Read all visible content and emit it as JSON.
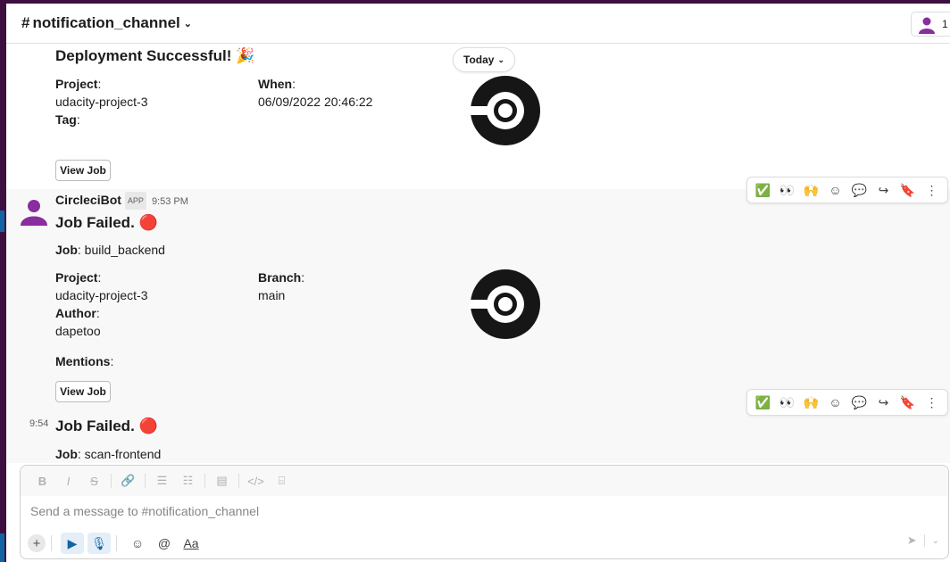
{
  "header": {
    "hash": "#",
    "channel": "notification_channel",
    "member_count": "1"
  },
  "today_label": "Today",
  "msg1": {
    "title": "Deployment Successful! 🎉",
    "project_label": "Project",
    "project_value": "udacity-project-3",
    "when_label": "When",
    "when_value": "06/09/2022 20:46:22",
    "tag_label": "Tag",
    "button": "View Job"
  },
  "msg2": {
    "sender": "CircleciBot",
    "badge": "APP",
    "time": "9:53 PM",
    "title": "Job Failed. 🔴",
    "job_label": "Job",
    "job_value": "build_backend",
    "project_label": "Project",
    "project_value": "udacity-project-3",
    "branch_label": "Branch",
    "branch_value": "main",
    "author_label": "Author",
    "author_value": "dapetoo",
    "mentions_label": "Mentions",
    "button": "View Job"
  },
  "msg3": {
    "time": "9:54",
    "title": "Job Failed. 🔴",
    "job_label": "Job",
    "job_value": "scan-frontend"
  },
  "composer": {
    "placeholder": "Send a message to #notification_channel",
    "format_text": "Aa"
  },
  "colors": {
    "sidebar": "#3f0e40",
    "accent": "#1264a3",
    "avatar": "#8a2d9e"
  }
}
